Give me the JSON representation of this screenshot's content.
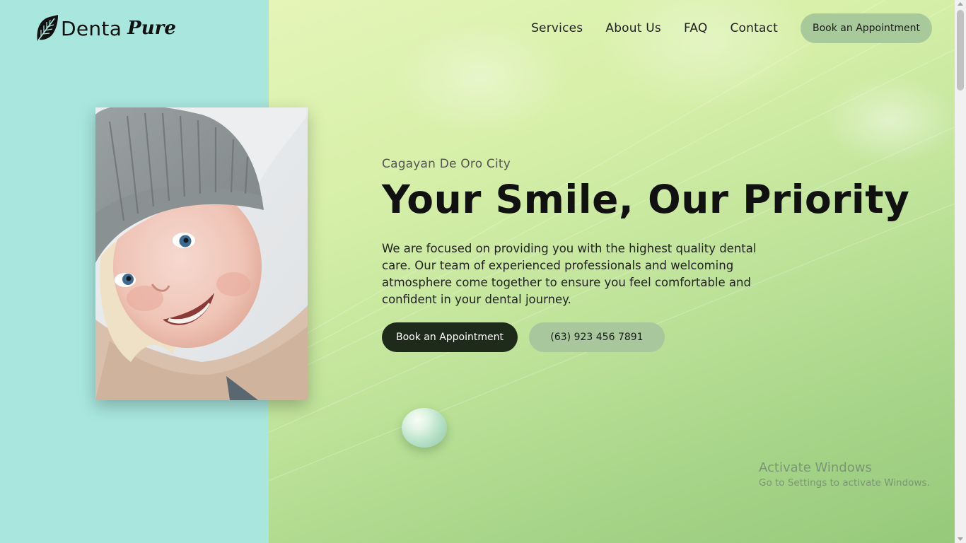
{
  "brand": {
    "name_part1": "Denta",
    "name_part2": "Pure",
    "icon": "leaf-icon"
  },
  "nav": {
    "items": [
      {
        "label": "Services"
      },
      {
        "label": "About Us"
      },
      {
        "label": "FAQ"
      },
      {
        "label": "Contact"
      }
    ],
    "cta_label": "Book an Appointment"
  },
  "hero": {
    "location": "Cagayan De Oro City",
    "headline": "Your Smile, Our Priority",
    "description": "We are focused on providing you with the highest quality dental care. Our team of experienced professionals and welcoming atmosphere come together to ensure you feel comfortable and confident in your dental journey.",
    "primary_button": "Book an Appointment",
    "phone_button": "(63) 923 456 7891"
  },
  "watermark": {
    "title": "Activate Windows",
    "subtitle": "Go to Settings to activate Windows."
  },
  "colors": {
    "left_panel": "#a8e6de",
    "primary_button": "#1e2a1a",
    "secondary_button": "#a9c79c"
  }
}
